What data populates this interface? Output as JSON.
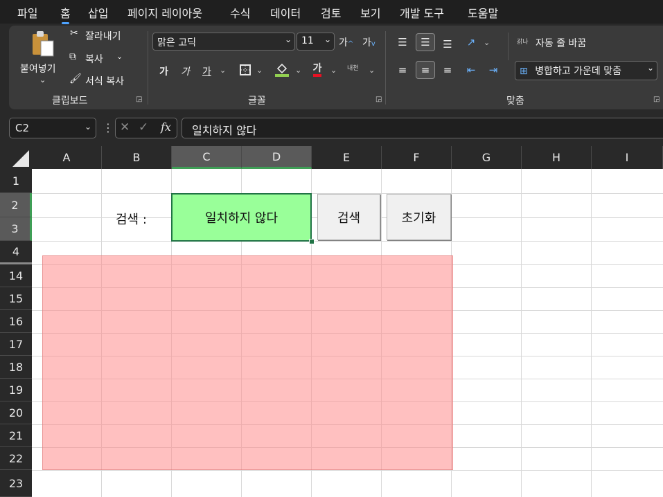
{
  "menu": [
    "파일",
    "홈",
    "삽입",
    "페이지 레이아웃",
    "수식",
    "데이터",
    "검토",
    "보기",
    "개발 도구",
    "도움말"
  ],
  "ribbon": {
    "clipboard": {
      "paste_label": "붙여넣기",
      "cut_label": "잘라내기",
      "copy_label": "복사",
      "format_painter_label": "서식 복사",
      "group_label": "클립보드"
    },
    "font": {
      "font_name": "맑은 고딕",
      "font_size": "11",
      "grow_label": "가",
      "shrink_label": "가",
      "bold": "가",
      "italic": "가",
      "underline": "가",
      "font_color_glyph": "가",
      "phonetic_label": "내천",
      "group_label": "글꼴"
    },
    "alignment": {
      "wrap_text_label": "자동 줄 바꿈",
      "wrap_icon_glyph": "갉나",
      "merge_center_label": "병합하고 가운데 맞춤",
      "group_label": "맞춤"
    }
  },
  "formula_bar": {
    "name_box": "C2",
    "fx_label": "fx",
    "content": "일치하지 않다"
  },
  "columns": [
    "A",
    "B",
    "C",
    "D",
    "E",
    "F",
    "G",
    "H",
    "I"
  ],
  "rows": [
    "1",
    "2",
    "3",
    "4",
    "14",
    "15",
    "16",
    "17",
    "18",
    "19",
    "20",
    "21",
    "22",
    "23"
  ],
  "sheet": {
    "search_label": "검색 :",
    "search_value": "일치하지 않다",
    "search_button": "검색",
    "reset_button": "초기화"
  },
  "colors": {
    "accent_green": "#217346",
    "search_cell_fill": "#99ff99",
    "overlay_shape_fill": "#ff8c8c",
    "font_color_underline": "#e81123",
    "fill_color_underline": "#92d050"
  }
}
